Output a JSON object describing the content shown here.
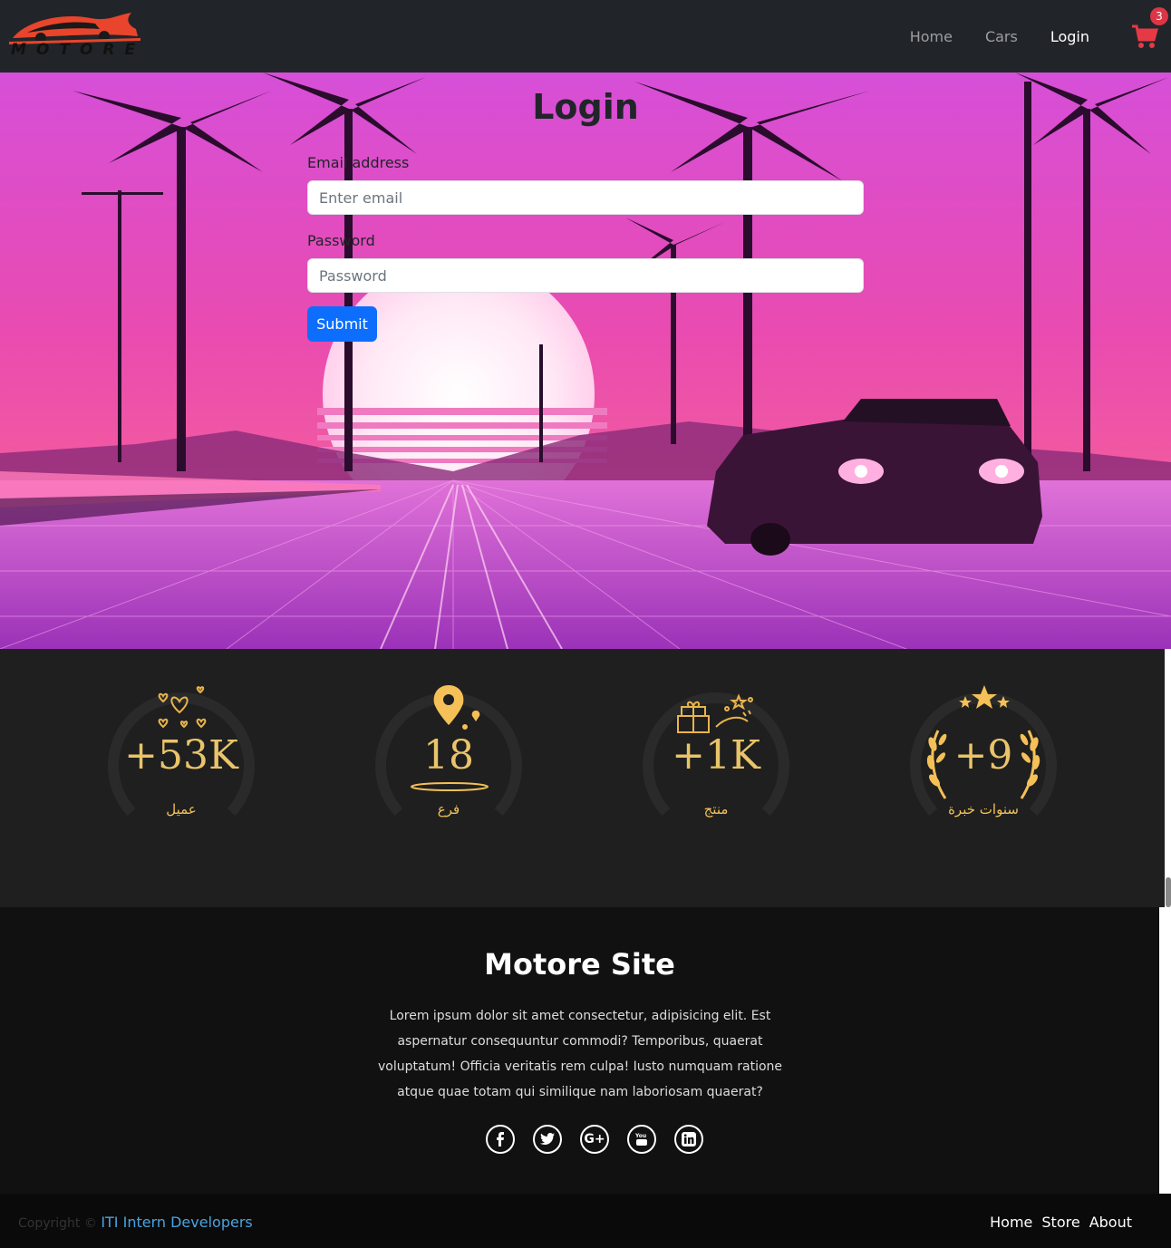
{
  "brand": {
    "logo_text": "MOTORE"
  },
  "nav": {
    "home": "Home",
    "cars": "Cars",
    "login": "Login",
    "cart_count": "3"
  },
  "login": {
    "title": "Login",
    "email_label": "Email address",
    "email_placeholder": "Enter email",
    "password_label": "Password",
    "password_placeholder": "Password",
    "submit": "Submit"
  },
  "stats": [
    {
      "value": "+53K",
      "label": "عميل",
      "icon": "hearts-icon"
    },
    {
      "value": "18",
      "label": "فرع",
      "icon": "location-pin-icon"
    },
    {
      "value": "+1K",
      "label": "منتج",
      "icon": "gifts-icon"
    },
    {
      "value": "+9",
      "label": "سنوات خبرة",
      "icon": "laurel-stars-icon"
    }
  ],
  "footer": {
    "title": "Motore Site",
    "text": "Lorem ipsum dolor sit amet consectetur, adipisicing elit. Est aspernatur consequuntur commodi? Temporibus, quaerat voluptatum! Officia veritatis rem culpa! Iusto numquam ratione atque quae totam qui similique nam laboriosam quaerat?",
    "socials": [
      "facebook-icon",
      "twitter-icon",
      "google-plus-icon",
      "youtube-icon",
      "linkedin-icon"
    ]
  },
  "bottom": {
    "copyright": "Copyright ©",
    "brand": "ITI Intern Developers",
    "links": [
      "Home",
      "Store",
      "About"
    ]
  },
  "colors": {
    "accent": "#0d6efd",
    "gold": "#f4c057",
    "badge": "#dc3545",
    "cart": "#e63946"
  }
}
